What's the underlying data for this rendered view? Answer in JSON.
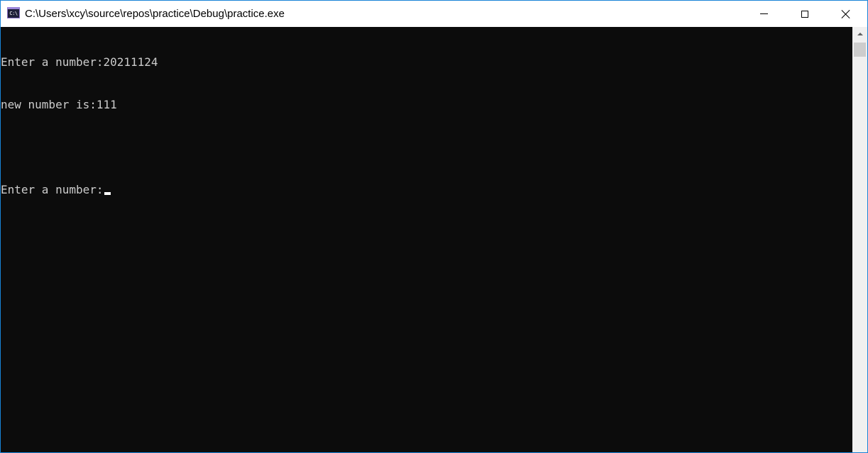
{
  "window": {
    "title": "C:\\Users\\xcy\\source\\repos\\practice\\Debug\\practice.exe",
    "icon": "console-app-icon",
    "icon_text": "C:\\",
    "border_color": "#1883d7"
  },
  "console": {
    "background": "#0c0c0c",
    "foreground": "#cccccc",
    "lines": [
      "Enter a number:20211124",
      "new number is:111",
      "",
      "Enter a number:"
    ]
  },
  "scrollbar": {
    "up_arrow_icon": "chevron-up-icon"
  }
}
